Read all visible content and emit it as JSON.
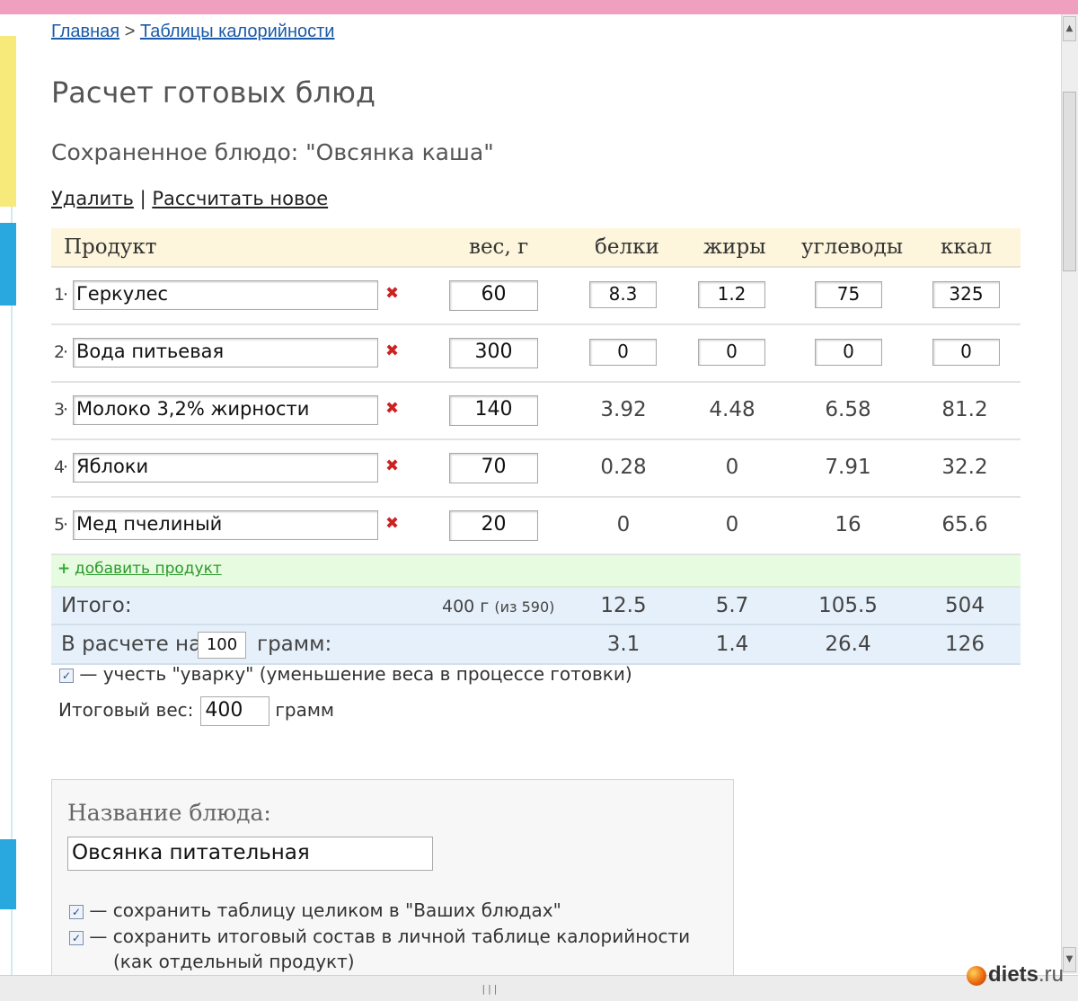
{
  "breadcrumb": {
    "home": "Главная",
    "sep": ">",
    "tables": "Таблицы калорийности"
  },
  "page_title": "Расчет готовых блюд",
  "saved_dish": "Сохраненное блюдо: \"Овсянка каша\"",
  "actions": {
    "delete": "Удалить",
    "sep": "|",
    "new_calc": "Рассчитать новое"
  },
  "table": {
    "headers": {
      "product": "Продукт",
      "weight": "вес, г",
      "protein": "белки",
      "fat": "жиры",
      "carbs": "углеводы",
      "kcal": "ккал"
    },
    "rows": [
      {
        "num": "1",
        "name": "Геркулес",
        "weight": "60",
        "protein": "8.3",
        "fat": "1.2",
        "carbs": "75",
        "kcal": "325"
      },
      {
        "num": "2",
        "name": "Вода питьевая",
        "weight": "300",
        "protein": "0",
        "fat": "0",
        "carbs": "0",
        "kcal": "0"
      },
      {
        "num": "3",
        "name": "Молоко 3,2% жирности",
        "weight": "140",
        "protein": "3.92",
        "fat": "4.48",
        "carbs": "6.58",
        "kcal": "81.2"
      },
      {
        "num": "4",
        "name": "Яблоки",
        "weight": "70",
        "protein": "0.28",
        "fat": "0",
        "carbs": "7.91",
        "kcal": "32.2"
      },
      {
        "num": "5",
        "name": "Мед пчелиный",
        "weight": "20",
        "protein": "0",
        "fat": "0",
        "carbs": "16",
        "kcal": "65.6"
      }
    ],
    "delete_icon": "✖",
    "add_product": "добавить продукт",
    "total": {
      "label": "Итого:",
      "weight": "400 г",
      "weight_of": "(из 590)",
      "protein": "12.5",
      "fat": "5.7",
      "carbs": "105.5",
      "kcal": "504"
    },
    "per": {
      "label_pre": "В расчете на",
      "amount": "100",
      "label_post": "грамм:",
      "protein": "3.1",
      "fat": "1.4",
      "carbs": "26.4",
      "kcal": "126"
    }
  },
  "shrink": {
    "checked": true,
    "text": "— учесть \"уварку\" (уменьшение веса в процессе готовки)"
  },
  "final_weight": {
    "label": "Итоговый вес:",
    "value": "400",
    "unit": "грамм"
  },
  "save_panel": {
    "name_label": "Название блюда:",
    "name_value": "Овсянка питательная",
    "opt1": "— сохранить таблицу целиком в \"Ваших блюдах\"",
    "opt2": "— сохранить итоговый состав в личной таблице калорийности",
    "opt2_cont": "(как отдельный продукт)"
  },
  "logo": {
    "name": "diets",
    "tld": ".ru"
  },
  "colors": {
    "link": "#1a5aa8",
    "header_bg": "#fdf5dc",
    "add_bg": "#e7fbe1",
    "total_bg": "#e6f0fa",
    "delete": "#cc2222"
  },
  "icons": {
    "delete": "close-icon",
    "add": "plus-icon",
    "checkbox": "checkmark-icon"
  }
}
